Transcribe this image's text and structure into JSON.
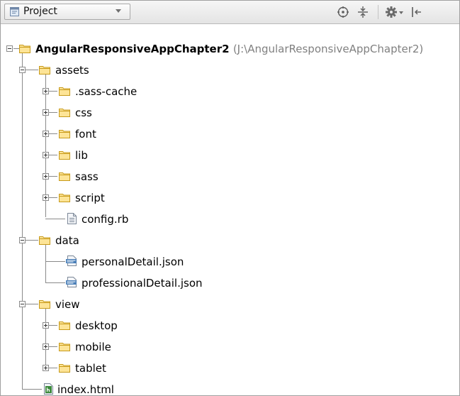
{
  "toolbar": {
    "view_label": "Project",
    "icons": [
      "project-view-icon",
      "dropdown-arrow-icon",
      "locate-icon",
      "collapse-all-icon",
      "gear-icon",
      "hide-icon"
    ]
  },
  "colors": {
    "folder_fill": "#fde497",
    "folder_stroke": "#c79a1a",
    "tree_line": "#8a8a8a",
    "path_text": "#808080"
  },
  "tree": {
    "root": {
      "name": "AngularResponsiveAppChapter2",
      "path": "(J:\\AngularResponsiveAppChapter2)"
    },
    "assets": {
      "name": "assets",
      "children": [
        ".sass-cache",
        "css",
        "font",
        "lib",
        "sass",
        "script"
      ],
      "file": "config.rb"
    },
    "data": {
      "name": "data",
      "files": [
        "personalDetail.json",
        "professionalDetail.json"
      ]
    },
    "view": {
      "name": "view",
      "children": [
        "desktop",
        "mobile",
        "tablet"
      ]
    },
    "index_file": "index.html"
  }
}
